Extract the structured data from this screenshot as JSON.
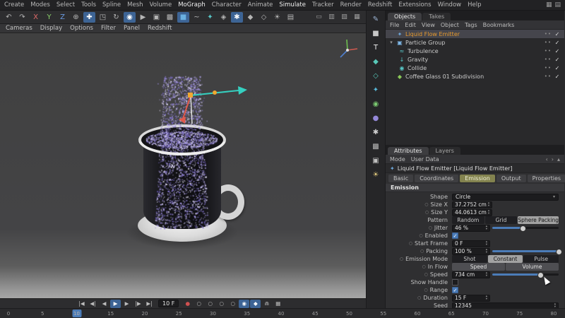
{
  "colors": {
    "accent_blue": "#4b7cb8",
    "selection_orange": "#e79a2e",
    "tab_active_olive": "#83834f",
    "record_red": "#d05050",
    "particle_palette": [
      "#d9d2f7",
      "#b3a6ec",
      "#9b8ce0",
      "#8273cc",
      "#6f5fc0",
      "#e8e3fa"
    ]
  },
  "icons": {
    "check": "✓",
    "kdot": "○",
    "expand": "▾",
    "dropdown": "▾",
    "up": "▴",
    "down": "▾",
    "dot_pair": "••",
    "emitter": "✦",
    "group": "▣",
    "turbulence": "≈",
    "gravity": "↓",
    "collide": "◉",
    "mesh": "◆"
  },
  "menubar": {
    "items": [
      "Create",
      "Modes",
      "Select",
      "Tools",
      "Spline",
      "Mesh",
      "Volume",
      {
        "label": "MoGraph",
        "name": "menu-mograph",
        "active": true
      },
      "Character",
      "Animate",
      {
        "label": "Simulate",
        "name": "menu-simulate",
        "active": true
      },
      "Tracker",
      "Render",
      "Redshift",
      "Extensions",
      "Window",
      "Help"
    ],
    "right_icons": [
      {
        "name": "interface-layout-icon",
        "glyph": "▦"
      },
      {
        "name": "preset-layout-icon",
        "glyph": "▤"
      }
    ]
  },
  "toolbar": {
    "icons": [
      {
        "name": "undo-icon",
        "glyph": "↶"
      },
      {
        "name": "redo-icon",
        "glyph": "↷"
      },
      {
        "name": "axis-x-toggle",
        "glyph": "X",
        "color": "#e06a6a"
      },
      {
        "name": "axis-y-toggle",
        "glyph": "Y",
        "color": "#8ad06a"
      },
      {
        "name": "axis-z-toggle",
        "glyph": "Z",
        "color": "#6a9ae0"
      },
      {
        "name": "coord-system-toggle",
        "glyph": "⊕"
      },
      {
        "name": "move-tool-icon",
        "glyph": "✚",
        "active": true
      },
      {
        "name": "scale-tool-icon",
        "glyph": "◳"
      },
      {
        "name": "rotate-tool-icon",
        "glyph": "↻"
      },
      {
        "name": "live-selection-icon",
        "glyph": "◉",
        "active": true
      },
      {
        "name": "render-view-icon",
        "glyph": "▶"
      },
      {
        "name": "render-picture-viewer-icon",
        "glyph": "▣"
      },
      {
        "name": "render-settings-icon",
        "glyph": "▩"
      },
      {
        "name": "add-primitive-icon",
        "glyph": "■",
        "color": "#6ab0e0",
        "active": true
      },
      {
        "name": "add-spline-icon",
        "glyph": "~"
      },
      {
        "name": "mograph-menu-icon",
        "glyph": "✦",
        "color": "#58c8c8"
      },
      {
        "name": "fields-icon",
        "glyph": "◈"
      },
      {
        "name": "simulate-menu-icon",
        "glyph": "✱",
        "active": true
      },
      {
        "name": "volume-menu-icon",
        "glyph": "◆"
      },
      {
        "name": "deformer-menu-icon",
        "glyph": "◇"
      },
      {
        "name": "environment-icon",
        "glyph": "☀"
      },
      {
        "name": "camera-add-icon",
        "glyph": "▤"
      }
    ],
    "view_icons": [
      {
        "name": "layout-single-view-icon",
        "glyph": "▭"
      },
      {
        "name": "layout-two-views-icon",
        "glyph": "▥"
      },
      {
        "name": "layout-three-views-icon",
        "glyph": "▧"
      },
      {
        "name": "layout-four-views-icon",
        "glyph": "▦"
      }
    ]
  },
  "viewport_menu": {
    "items": [
      "Cameras",
      "Display",
      "Options",
      "Filter",
      "Panel",
      "Redshift"
    ]
  },
  "toolstrip": {
    "icons": [
      {
        "name": "pen-tool-icon",
        "glyph": "✎",
        "color": "#9fb8d8"
      },
      {
        "name": "cube-primitive-icon",
        "glyph": "■",
        "color": "#c8c8c8"
      },
      {
        "name": "text-object-icon",
        "glyph": "T",
        "color": "#f0f0f0"
      },
      {
        "name": "subdivision-surface-icon",
        "glyph": "◆",
        "color": "#58c8b8"
      },
      {
        "name": "extrude-object-icon",
        "glyph": "◇",
        "color": "#58c8b8"
      },
      {
        "name": "mograph-cloner-icon",
        "glyph": "✦",
        "color": "#58b8d8"
      },
      {
        "name": "field-object-icon",
        "glyph": "◉",
        "color": "#7ac870"
      },
      {
        "name": "volume-builder-icon",
        "glyph": "●",
        "color": "#9488d8"
      },
      {
        "name": "simulation-scene-icon",
        "glyph": "✱",
        "color": "#d0d0d0"
      },
      {
        "name": "deformer-icon",
        "glyph": "▩",
        "color": "#b8b8b8"
      },
      {
        "name": "camera-object-icon",
        "glyph": "▣",
        "color": "#c0c0c0"
      },
      {
        "name": "light-object-icon",
        "glyph": "☀",
        "color": "#e8d080"
      }
    ]
  },
  "objects_panel": {
    "tabs": [
      {
        "label": "Objects",
        "active": true
      },
      {
        "label": "Takes",
        "active": false
      }
    ],
    "menu": [
      "File",
      "Edit",
      "View",
      "Object",
      "Tags",
      "Bookmarks"
    ],
    "tree": [
      {
        "label": "Liquid Flow Emitter",
        "depth": 0,
        "selected": true
      },
      {
        "label": "Particle Group",
        "depth": 0,
        "expanded": true
      },
      {
        "label": "Turbulence",
        "depth": 1
      },
      {
        "label": "Gravity",
        "depth": 1
      },
      {
        "label": "Collide",
        "depth": 1
      },
      {
        "label": "Coffee Glass 01 Subdivision",
        "depth": 0
      }
    ]
  },
  "attributes_panel": {
    "tabs": [
      {
        "label": "Attributes",
        "active": true
      },
      {
        "label": "Layers",
        "active": false
      }
    ],
    "menu": [
      "Mode",
      "User Data"
    ],
    "nav_icons": [
      {
        "name": "history-back-icon",
        "glyph": "‹"
      },
      {
        "name": "history-forward-icon",
        "glyph": "›"
      },
      {
        "name": "parent-object-icon",
        "glyph": "▴"
      }
    ],
    "title": "Liquid Flow Emitter [Liquid Flow Emitter]",
    "section_tabs": [
      "Basic",
      "Coordinates",
      "Emission",
      "Output",
      "Properties"
    ],
    "active_section_tab": "Emission",
    "section_header": "Emission",
    "shape": {
      "label": "Shape",
      "value": "Circle"
    },
    "size_x": {
      "label": "Size X",
      "value": "37.2752 cm"
    },
    "size_y": {
      "label": "Size Y",
      "value": "44.0613 cm"
    },
    "pattern": {
      "label": "Pattern",
      "options": [
        "Random",
        "Grid",
        "Sphere Packing"
      ],
      "selected": "Sphere Packing"
    },
    "jitter": {
      "label": "Jitter",
      "value": "46 %",
      "percent": 46
    },
    "enabled": {
      "label": "Enabled",
      "checked": true
    },
    "start_frame": {
      "label": "Start Frame",
      "value": "0 F"
    },
    "packing": {
      "label": "Packing",
      "value": "100 %",
      "percent": 100
    },
    "emission_mode": {
      "label": "Emission Mode",
      "options": [
        "Shot",
        "Constant",
        "Pulse"
      ],
      "selected": "Constant"
    },
    "in_flow": {
      "label": "In Flow",
      "options": [
        "Speed",
        "Volume"
      ]
    },
    "speed": {
      "label": "Speed",
      "value": "734 cm",
      "percent": 72
    },
    "show_handle": {
      "label": "Show Handle",
      "checked": false
    },
    "range": {
      "label": "Range",
      "checked": true
    },
    "duration": {
      "label": "Duration",
      "value": "15 F"
    },
    "seed": {
      "label": "Seed",
      "value": "12345"
    }
  },
  "transport": {
    "frame": "10 F",
    "buttons": [
      {
        "name": "goto-start-button",
        "glyph": "|◀"
      },
      {
        "name": "prev-key-button",
        "glyph": "◀|"
      },
      {
        "name": "prev-frame-button",
        "glyph": "◀"
      },
      {
        "name": "play-button",
        "glyph": "▶",
        "active": true
      },
      {
        "name": "next-frame-button",
        "glyph": "▶"
      },
      {
        "name": "next-key-button",
        "glyph": "|▶"
      },
      {
        "name": "goto-end-button",
        "glyph": "▶|"
      }
    ],
    "record_buttons": [
      {
        "name": "record-button",
        "glyph": "●",
        "color": "#d05050"
      },
      {
        "name": "record-position-toggle",
        "glyph": "○"
      },
      {
        "name": "record-scale-toggle",
        "glyph": "○"
      },
      {
        "name": "record-rotation-toggle",
        "glyph": "○"
      },
      {
        "name": "record-parameter-toggle",
        "glyph": "○"
      },
      {
        "name": "autokey-button",
        "glyph": "◉",
        "active": true
      },
      {
        "name": "keyframe-selection-button",
        "glyph": "◆",
        "active": true
      },
      {
        "name": "magnet-icon",
        "glyph": "⋒"
      },
      {
        "name": "snap-settings-icon",
        "glyph": "▦"
      }
    ]
  },
  "timeline": {
    "start": 0,
    "end": 80,
    "current": 10,
    "labels": [
      "0",
      "5",
      "10",
      "15",
      "20",
      "25",
      "30",
      "35",
      "40",
      "45",
      "50",
      "55",
      "60",
      "65",
      "70",
      "75",
      "80"
    ]
  }
}
